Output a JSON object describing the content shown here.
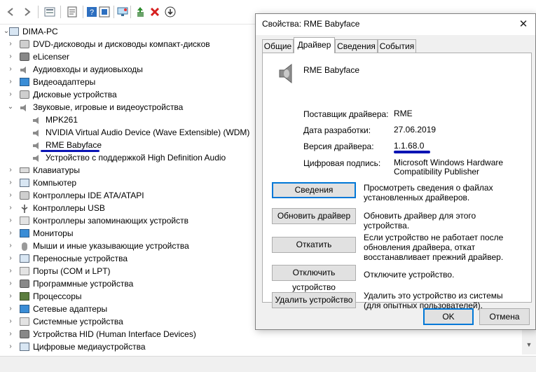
{
  "toolbar": {
    "icons": [
      "back-icon",
      "forward-icon",
      "show-hide-icon",
      "properties-icon",
      "help-icon",
      "view-icon",
      "monitor-scan-icon",
      "update-driver-icon",
      "uninstall-icon",
      "disable-icon"
    ]
  },
  "tree": {
    "root": "DIMA-PC",
    "categories": [
      "DVD-дисководы и дисководы компакт-дисков",
      "eLicenser",
      "Аудиовходы и аудиовыходы",
      "Видеоадаптеры",
      "Дисковые устройства",
      "Звуковые, игровые и видеоустройства"
    ],
    "sound_devices": [
      "MPK261",
      "NVIDIA Virtual Audio Device (Wave Extensible) (WDM)",
      "RME Babyface",
      "Устройство с поддержкой High Definition Audio"
    ],
    "categories_after": [
      "Клавиатуры",
      "Компьютер",
      "Контроллеры IDE ATA/ATAPI",
      "Контроллеры USB",
      "Контроллеры запоминающих устройств",
      "Мониторы",
      "Мыши и иные указывающие устройства",
      "Переносные устройства",
      "Порты (COM и LPT)",
      "Программные устройства",
      "Процессоры",
      "Сетевые адаптеры",
      "Системные устройства",
      "Устройства HID (Human Interface Devices)",
      "Цифровые медиаустройства"
    ]
  },
  "dialog": {
    "title": "Свойства: RME Babyface",
    "close": "✕",
    "tabs": [
      "Общие",
      "Драйвер",
      "Сведения",
      "События"
    ],
    "active_tab": "Драйвер",
    "device_name": "RME Babyface",
    "props": [
      {
        "label": "Поставщик драйвера:",
        "value": "RME"
      },
      {
        "label": "Дата разработки:",
        "value": "27.06.2019"
      },
      {
        "label": "Версия драйвера:",
        "value": "1.1.68.0"
      },
      {
        "label": "Цифровая подпись:",
        "value": "Microsoft Windows Hardware Compatibility Publisher"
      }
    ],
    "actions": [
      {
        "label": "Сведения",
        "desc": "Просмотреть сведения о файлах установленных драйверов."
      },
      {
        "label": "Обновить драйвер",
        "desc": "Обновить драйвер для этого устройства."
      },
      {
        "label": "Откатить",
        "desc": "Если устройство не работает после обновления драйвера, откат восстанавливает прежний драйвер."
      },
      {
        "label": "Отключить устройство",
        "desc": "Отключите устройство."
      },
      {
        "label": "Удалить устройство",
        "desc": "Удалить это устройство из системы (для опытных пользователей)."
      }
    ],
    "ok": "OK",
    "cancel": "Отмена"
  },
  "colors": {
    "accent": "#0078d7",
    "annotation": "#0a14b4",
    "dialog_bg": "#f0f0f0"
  }
}
